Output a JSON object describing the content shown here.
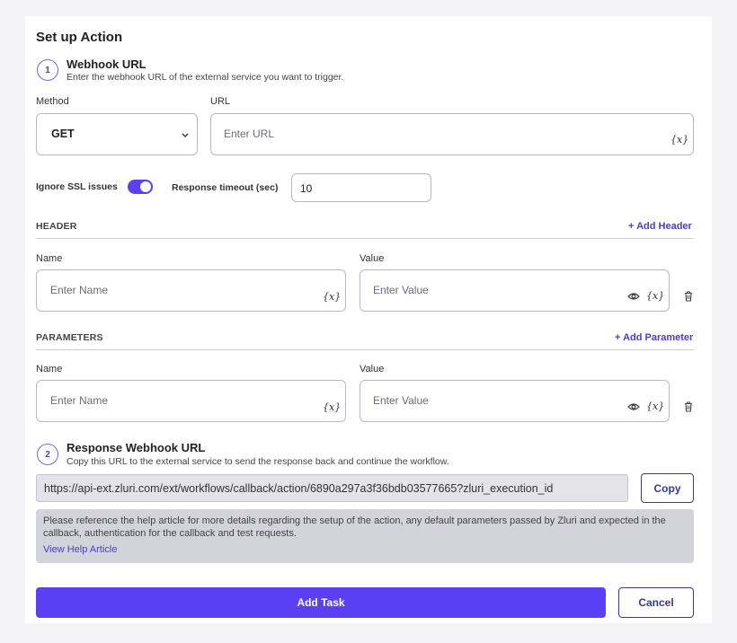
{
  "page_title": "Set up Action",
  "step1": {
    "number": "1",
    "title": "Webhook URL",
    "subtitle": "Enter the webhook URL of the external service you want to trigger."
  },
  "method": {
    "label": "Method",
    "value": "GET"
  },
  "url": {
    "label": "URL",
    "placeholder": "Enter URL"
  },
  "variable_icon_text": "{x}",
  "ssl": {
    "label": "Ignore SSL issues",
    "enabled": true
  },
  "timeout": {
    "label": "Response timeout (sec)",
    "value": "10"
  },
  "header": {
    "section_label": "HEADER",
    "add_label": "+ Add Header",
    "name_label": "Name",
    "value_label": "Value",
    "name_placeholder": "Enter Name",
    "value_placeholder": "Enter Value"
  },
  "parameters": {
    "section_label": "PARAMETERS",
    "add_label": "+ Add Parameter",
    "name_label": "Name",
    "value_label": "Value",
    "name_placeholder": "Enter Name",
    "value_placeholder": "Enter Value"
  },
  "step2": {
    "number": "2",
    "title": "Response Webhook URL",
    "subtitle": "Copy this URL to the external service to send the response back and continue the workflow."
  },
  "callback_url": "https://api-ext.zluri.com/ext/workflows/callback/action/6890a297a3f36bdb03577665?zluri_execution_id",
  "copy_label": "Copy",
  "help": {
    "text": "Please reference the help article for more details regarding the setup of the action, any default parameters passed by Zluri and expected in the callback, authentication for the callback and test requests.",
    "link": "View Help Article"
  },
  "footer": {
    "primary_label": "Add Task",
    "cancel_label": "Cancel"
  },
  "colors": {
    "accent": "#5b3ff5",
    "link": "#4a3fb8"
  },
  "icons": [
    "chevron-down-icon",
    "variable-icon",
    "eye-icon",
    "trash-icon"
  ]
}
